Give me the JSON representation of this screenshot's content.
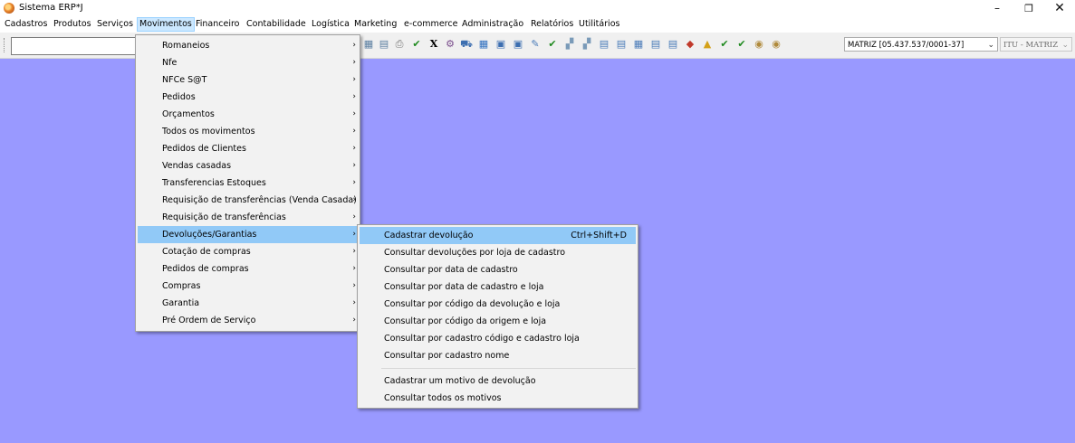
{
  "window": {
    "title": "Sistema ERP*J"
  },
  "menubar": [
    "Cadastros",
    "Produtos",
    "Serviços",
    "Movimentos",
    "Financeiro",
    "Contabilidade",
    "Logística",
    "Marketing",
    "e-commerce",
    "Administração",
    "Relatórios",
    "Utilitários"
  ],
  "toolbar": {
    "search_value": "",
    "company": "MATRIZ [05.437.537/0001-37]",
    "store": "ITU - MATRIZ"
  },
  "movimentos_menu": [
    "Romaneios",
    "Nfe",
    "NFCe S@T",
    "Pedidos",
    "Orçamentos",
    "Todos os movimentos",
    "Pedidos de Clientes",
    "Vendas casadas",
    "Transferencias Estoques",
    "Requisição de transferências (Venda Casada)",
    "Requisição de transferências",
    "Devoluções/Garantias",
    "Cotação de compras",
    "Pedidos de compras",
    "Compras",
    "Garantia",
    "Pré Ordem de Serviço"
  ],
  "devolucoes_menu": {
    "items": [
      {
        "label": "Cadastrar devolução",
        "shortcut": "Ctrl+Shift+D"
      },
      {
        "label": "Consultar devoluções por loja de cadastro"
      },
      {
        "label": "Consultar por data de cadastro"
      },
      {
        "label": "Consultar por data de cadastro e loja"
      },
      {
        "label": "Consultar por código da devolução e loja"
      },
      {
        "label": "Consultar por código da origem e loja"
      },
      {
        "label": "Consultar por cadastro código e cadastro loja"
      },
      {
        "label": "Consultar por cadastro nome"
      },
      {
        "label": "Cadastrar um motivo de devolução"
      },
      {
        "label": "Consultar todos os motivos"
      }
    ]
  },
  "colors": {
    "desktop": "#9999ff",
    "highlight": "#91c9f7",
    "menubar_active": "#cce8ff"
  }
}
